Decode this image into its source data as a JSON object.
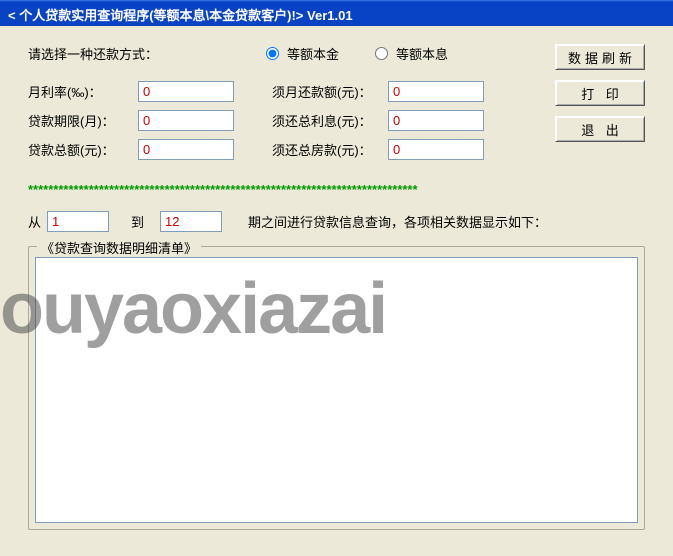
{
  "window": {
    "title": "< 个人贷款实用查询程序(等额本息\\本金贷款客户)!> Ver1.01"
  },
  "prompt": "请选择一种还款方式：",
  "radios": {
    "principal": "等额本金",
    "interest": "等额本息"
  },
  "buttons": {
    "refresh": "数据刷新",
    "print": "打 印",
    "exit": "退 出"
  },
  "labels": {
    "monthly_rate": "月利率(‰)：",
    "term_months": "贷款期限(月)：",
    "loan_total": "贷款总额(元)：",
    "payment_per": "须月还款额(元)：",
    "total_interest": "须还总利息(元)：",
    "total_repay": "须还总房款(元)："
  },
  "values": {
    "monthly_rate": "0",
    "term_months": "0",
    "loan_total": "0",
    "payment_per": "0",
    "total_interest": "0",
    "total_repay": "0"
  },
  "divider": "*****************************************************************************",
  "range": {
    "from_label": "从",
    "from_value": "1",
    "to_label": "到",
    "to_value": "12",
    "suffix": "期之间进行贷款信息查询，各项相关数据显示如下："
  },
  "groupbox_title": "《贷款查询数据明细清单》",
  "watermark": "ouyaoxiazai"
}
